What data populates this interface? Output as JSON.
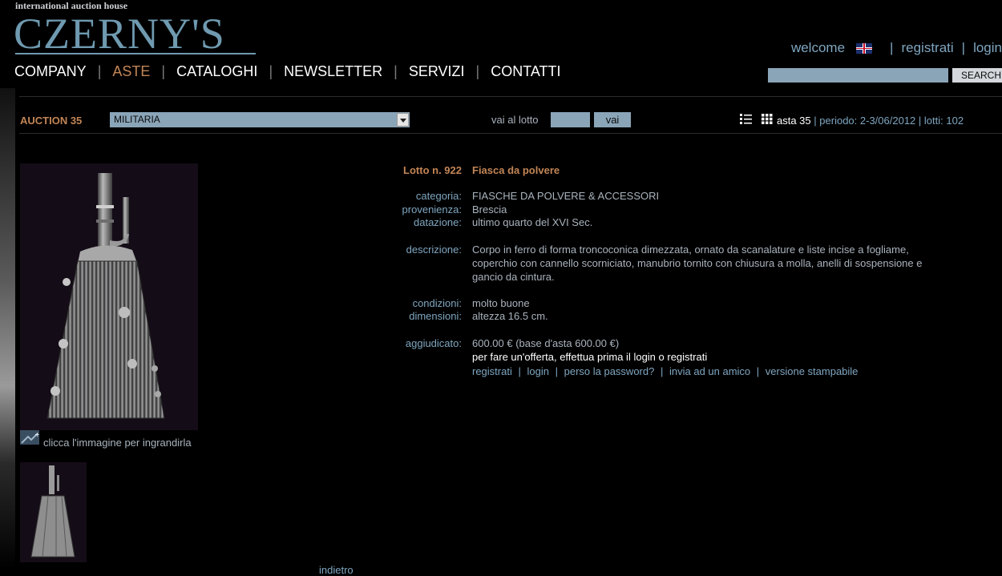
{
  "brand": {
    "tagline": "international auction house",
    "logo": "CZERNY'S"
  },
  "nav": {
    "company": "COMPANY",
    "aste": "ASTE",
    "cataloghi": "CATALOGHI",
    "newsletter": "NEWSLETTER",
    "servizi": "SERVIZI",
    "contatti": "CONTATTI",
    "separator": "|"
  },
  "top_right": {
    "welcome": "welcome",
    "registrati": "registrati",
    "login": "login",
    "separator": "|",
    "flag_icon": "uk-flag-icon"
  },
  "search": {
    "value": "",
    "button": "SEARCH"
  },
  "toolbar": {
    "auction_label": "AUCTION 35",
    "category_selected": "MILITARIA",
    "vai_al_lotto": "vai al lotto",
    "lot_input_value": "",
    "vai_button": "vai",
    "asta": "asta 35",
    "periodo": "periodo: 2-3/06/2012",
    "lotti": "lotti: 102",
    "sep": "|",
    "list_icon": "list-view-icon",
    "grid_icon": "grid-view-icon"
  },
  "image": {
    "zoom_hint": "clicca l'immagine per ingrandirla",
    "zoom_icon": "zoom-icon"
  },
  "lot": {
    "label": "Lotto n. 922",
    "title": "Fiasca da polvere",
    "fields": {
      "categoria_label": "categoria:",
      "categoria": "FIASCHE DA POLVERE & ACCESSORI",
      "provenienza_label": "provenienza:",
      "provenienza": "Brescia",
      "datazione_label": "datazione:",
      "datazione": "ultimo quarto del XVI Sec.",
      "descrizione_label": "descrizione:",
      "descrizione_1": "Corpo in ferro di forma troncoconica dimezzata, ornato da scanalature e liste incise a fogliame,",
      "descrizione_2": "coperchio con cannello scorniciato, manubrio tornito con chiusura a molla, anelli di sospensione e",
      "descrizione_3": "gancio da cintura.",
      "condizioni_label": "condizioni:",
      "condizioni": "molto buone",
      "dimensioni_label": "dimensioni:",
      "dimensioni": "altezza 16.5 cm.",
      "aggiudicato_label": "aggiudicato:",
      "aggiudicato": "600.00 € (base d'asta 600.00 €)",
      "offerta_note": "per fare un'offerta, effettua prima il login o registrati"
    },
    "links": {
      "registrati": "registrati",
      "login": "login",
      "perso_password": "perso la password?",
      "invia_amico": "invia ad un amico",
      "versione_stampabile": "versione stampabile",
      "sep": "|"
    }
  },
  "footer_cut": "indietro"
}
